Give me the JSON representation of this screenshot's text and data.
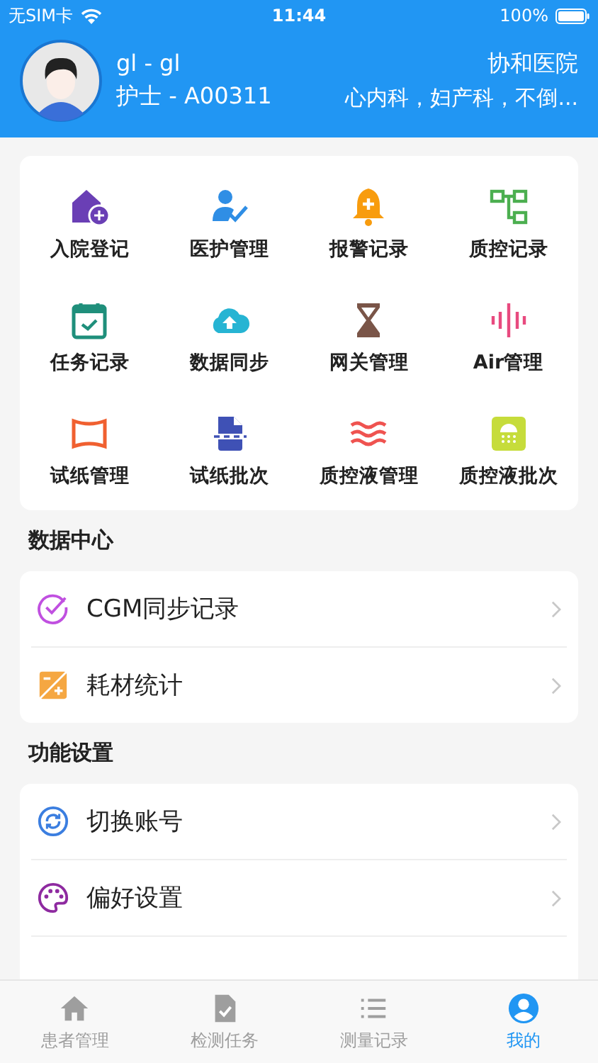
{
  "status_bar": {
    "carrier": "无SIM卡",
    "time": "11:44",
    "battery": "100%"
  },
  "profile": {
    "name": "gl - gl",
    "role": "护士 - A00311",
    "hospital": "协和医院",
    "departments": "心内科，妇产科，不倒..."
  },
  "shortcuts": [
    {
      "label": "入院登记"
    },
    {
      "label": "医护管理"
    },
    {
      "label": "报警记录"
    },
    {
      "label": "质控记录"
    },
    {
      "label": "任务记录"
    },
    {
      "label": "数据同步"
    },
    {
      "label": "网关管理"
    },
    {
      "label": "Air管理"
    },
    {
      "label": "试纸管理"
    },
    {
      "label": "试纸批次"
    },
    {
      "label": "质控液管理"
    },
    {
      "label": "质控液批次"
    }
  ],
  "sections": [
    {
      "title": "数据中心",
      "items": [
        {
          "label": "CGM同步记录"
        },
        {
          "label": "耗材统计"
        }
      ]
    },
    {
      "title": "功能设置",
      "items": [
        {
          "label": "切换账号"
        },
        {
          "label": "偏好设置"
        }
      ]
    }
  ],
  "tab_bar": [
    {
      "label": "患者管理",
      "selected": false
    },
    {
      "label": "检测任务",
      "selected": false
    },
    {
      "label": "测量记录",
      "selected": false
    },
    {
      "label": "我的",
      "selected": true
    }
  ]
}
